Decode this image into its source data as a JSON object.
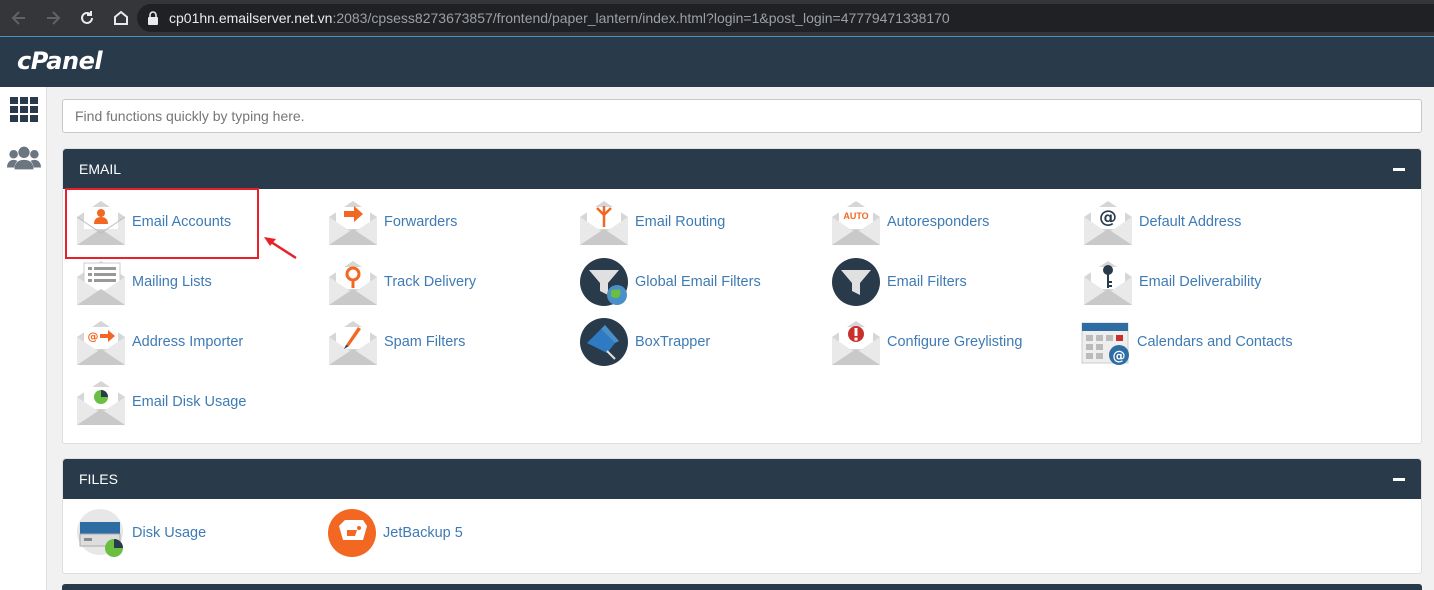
{
  "browser": {
    "url_host": "cp01hn.emailserver.net.vn",
    "url_path": ":2083/cpsess8273673857/frontend/paper_lantern/index.html?login=1&post_login=47779471338170"
  },
  "header": {
    "logo": "cPanel"
  },
  "search": {
    "placeholder": "Find functions quickly by typing here."
  },
  "email_section": {
    "title": "EMAIL",
    "items": [
      {
        "label": "Email Accounts",
        "icon": "email-accounts-icon"
      },
      {
        "label": "Forwarders",
        "icon": "forwarders-icon"
      },
      {
        "label": "Email Routing",
        "icon": "email-routing-icon"
      },
      {
        "label": "Autoresponders",
        "icon": "autoresponders-icon",
        "badge": "AUTO"
      },
      {
        "label": "Default Address",
        "icon": "default-address-icon"
      },
      {
        "label": "Mailing Lists",
        "icon": "mailing-lists-icon"
      },
      {
        "label": "Track Delivery",
        "icon": "track-delivery-icon"
      },
      {
        "label": "Global Email Filters",
        "icon": "global-email-filters-icon"
      },
      {
        "label": "Email Filters",
        "icon": "email-filters-icon"
      },
      {
        "label": "Email Deliverability",
        "icon": "email-deliverability-icon"
      },
      {
        "label": "Address Importer",
        "icon": "address-importer-icon"
      },
      {
        "label": "Spam Filters",
        "icon": "spam-filters-icon"
      },
      {
        "label": "BoxTrapper",
        "icon": "boxtrapper-icon"
      },
      {
        "label": "Configure Greylisting",
        "icon": "greylisting-icon"
      },
      {
        "label": "Calendars and Contacts",
        "icon": "calendars-contacts-icon"
      },
      {
        "label": "Email Disk Usage",
        "icon": "email-disk-usage-icon"
      }
    ]
  },
  "files_section": {
    "title": "FILES",
    "items": [
      {
        "label": "Disk Usage",
        "icon": "disk-usage-icon"
      },
      {
        "label": "JetBackup 5",
        "icon": "jetbackup-icon"
      }
    ]
  },
  "colors": {
    "header": "#293a4a",
    "link": "#3e7bb4",
    "accent": "#f26722",
    "highlight": "#e8202a"
  }
}
